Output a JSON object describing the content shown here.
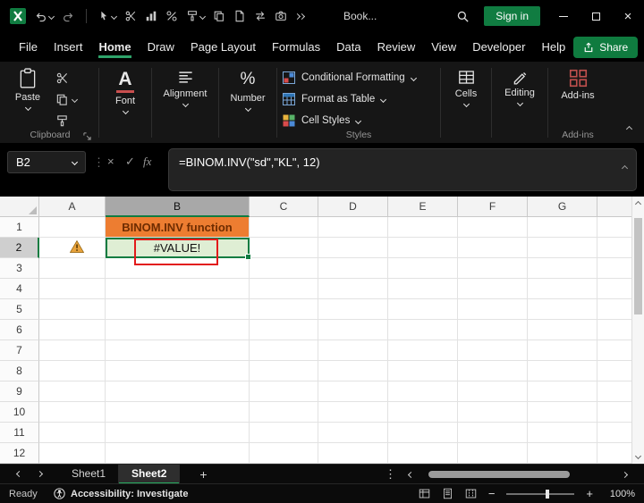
{
  "titlebar": {
    "doc_title": "Book...",
    "sign_in_label": "Sign in"
  },
  "menubar": {
    "items": [
      "File",
      "Insert",
      "Home",
      "Draw",
      "Page Layout",
      "Formulas",
      "Data",
      "Review",
      "View",
      "Developer",
      "Help"
    ],
    "active_item": "Home",
    "share_label": "Share"
  },
  "ribbon": {
    "clipboard": {
      "paste_label": "Paste",
      "group_label": "Clipboard"
    },
    "font": {
      "label": "Font"
    },
    "alignment": {
      "label": "Alignment"
    },
    "number": {
      "label": "Number"
    },
    "styles": {
      "items": [
        "Conditional Formatting",
        "Format as Table",
        "Cell Styles"
      ],
      "group_label": "Styles"
    },
    "cells": {
      "label": "Cells"
    },
    "editing": {
      "label": "Editing"
    },
    "addins": {
      "label": "Add-ins",
      "group_label": "Add-ins"
    }
  },
  "formula_bar": {
    "name_box": "B2",
    "fx_label": "fx",
    "formula": "=BINOM.INV(\"sd\",\"KL\", 12)"
  },
  "grid": {
    "columns": [
      "A",
      "B",
      "C",
      "D",
      "E",
      "F",
      "G"
    ],
    "rows": [
      "1",
      "2",
      "3",
      "4",
      "5",
      "6",
      "7",
      "8",
      "9",
      "10",
      "11",
      "12"
    ],
    "selected_cell": "B2",
    "selected_column": "B",
    "selected_row": "2",
    "cells": [
      {
        "ref": "B1",
        "value": "BINOM.INV function",
        "style": "title"
      },
      {
        "ref": "B2",
        "value": "#VALUE!",
        "style": "error"
      }
    ]
  },
  "sheet_tabs": {
    "tabs": [
      "Sheet1",
      "Sheet2"
    ],
    "active": "Sheet2"
  },
  "status_bar": {
    "mode": "Ready",
    "accessibility": "Accessibility: Investigate",
    "zoom": "100%"
  },
  "icons": {
    "close": "×",
    "cancel": "×",
    "check": "✓",
    "ellipsis": "⋮",
    "plus": "+",
    "minus": "−",
    "percent": "%",
    "font_letter": "A"
  },
  "colors": {
    "accent_green": "#107C41",
    "share_green": "#0F7B3F",
    "title_cell_orange": "#ED7D31",
    "error_cell_green": "#DFEED4",
    "annotation_red": "#E21B1B",
    "warning_orange": "#E8A33D"
  }
}
